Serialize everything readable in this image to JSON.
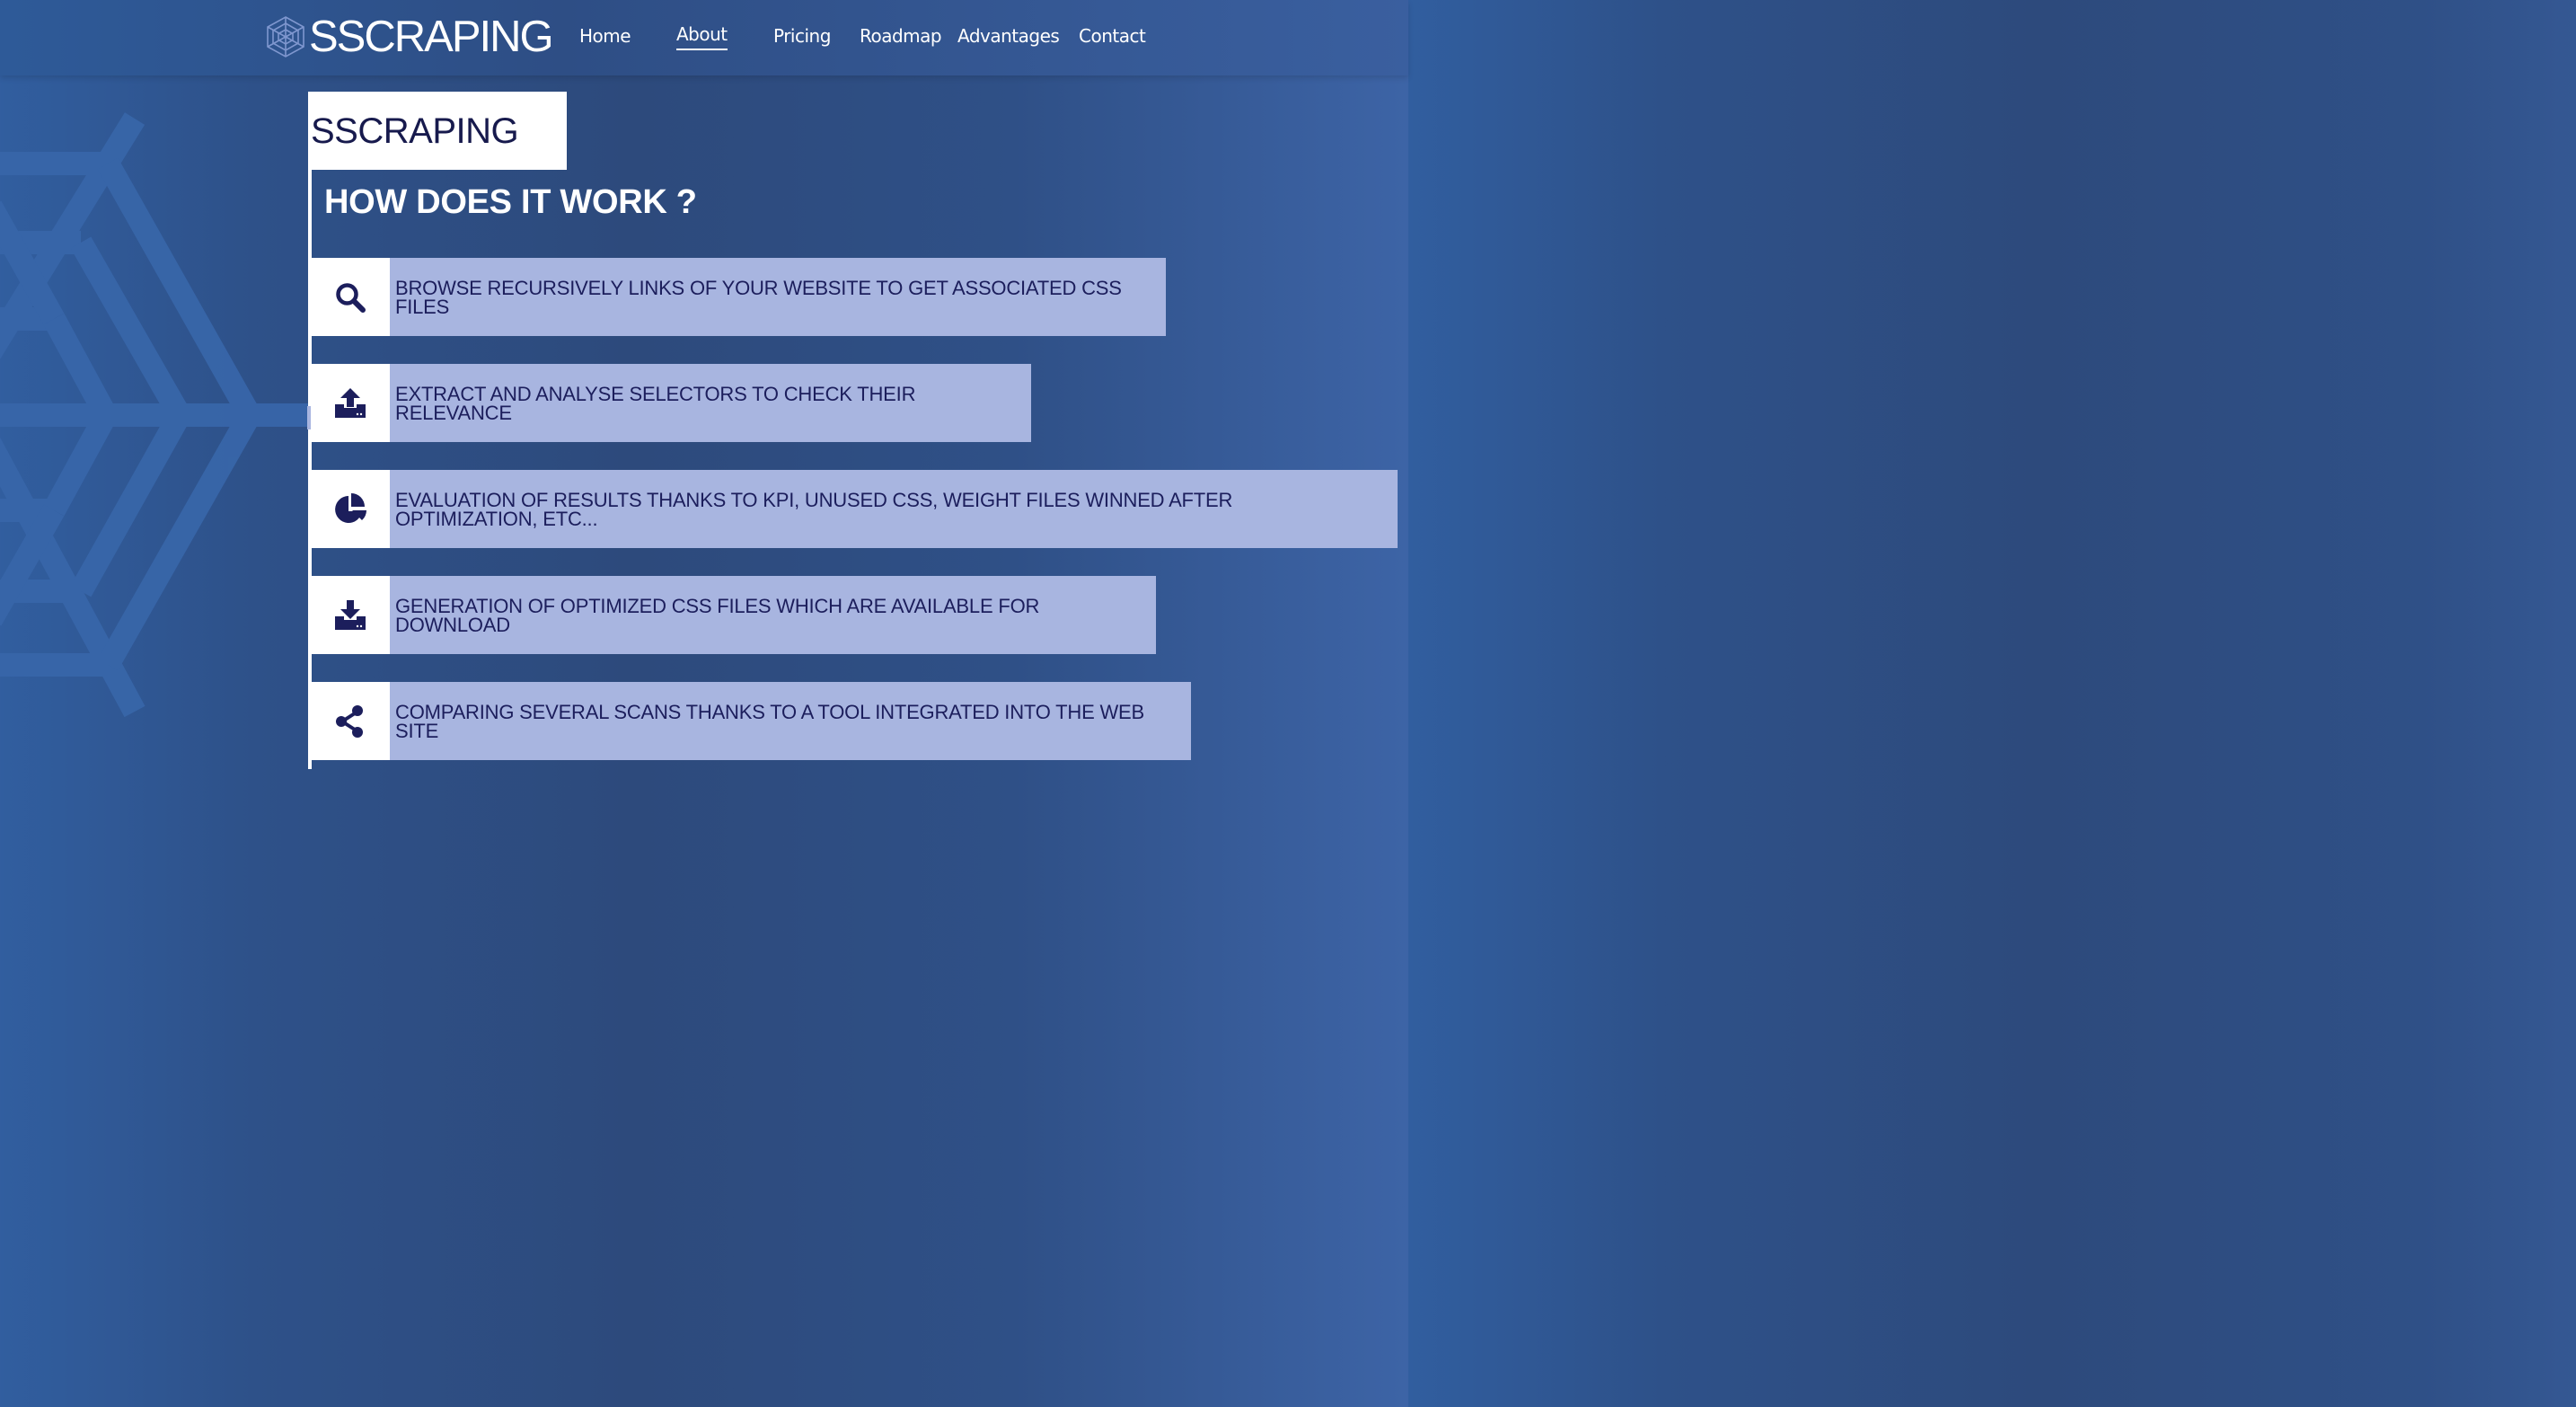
{
  "brand": {
    "logo_text": "SSCRAPING",
    "logo_icon": "spider-web-icon"
  },
  "nav": {
    "items": [
      {
        "label": "Home",
        "active": false
      },
      {
        "label": "About",
        "active": true
      },
      {
        "label": "Pricing",
        "active": false
      },
      {
        "label": "Roadmap",
        "active": false
      },
      {
        "label": "Advantages",
        "active": false
      },
      {
        "label": "Contact",
        "active": false
      }
    ]
  },
  "main": {
    "title": "SSCRAPING",
    "subtitle": "HOW DOES IT WORK ?",
    "steps": [
      {
        "icon": "search-icon",
        "text": "BROWSE RECURSIVELY LINKS OF YOUR WEBSITE TO GET ASSOCIATED CSS FILES"
      },
      {
        "icon": "upload-icon",
        "text": "EXTRACT AND ANALYSE SELECTORS TO CHECK THEIR RELEVANCE"
      },
      {
        "icon": "pie-chart-icon",
        "text": "EVALUATION OF RESULTS THANKS TO KPI, UNUSED CSS, WEIGHT FILES WINNED AFTER OPTIMIZATION, ETC..."
      },
      {
        "icon": "download-icon",
        "text": "GENERATION OF OPTIMIZED CSS FILES WHICH ARE AVAILABLE FOR DOWNLOAD"
      },
      {
        "icon": "share-icon",
        "text": "COMPARING SEVERAL SCANS THANKS TO A TOOL INTEGRATED INTO THE WEB SITE"
      }
    ]
  },
  "colors": {
    "background": "#2d4a7c",
    "accent_bar": "#a8b5e0",
    "text_dark": "#1c1e5c",
    "white": "#ffffff"
  }
}
